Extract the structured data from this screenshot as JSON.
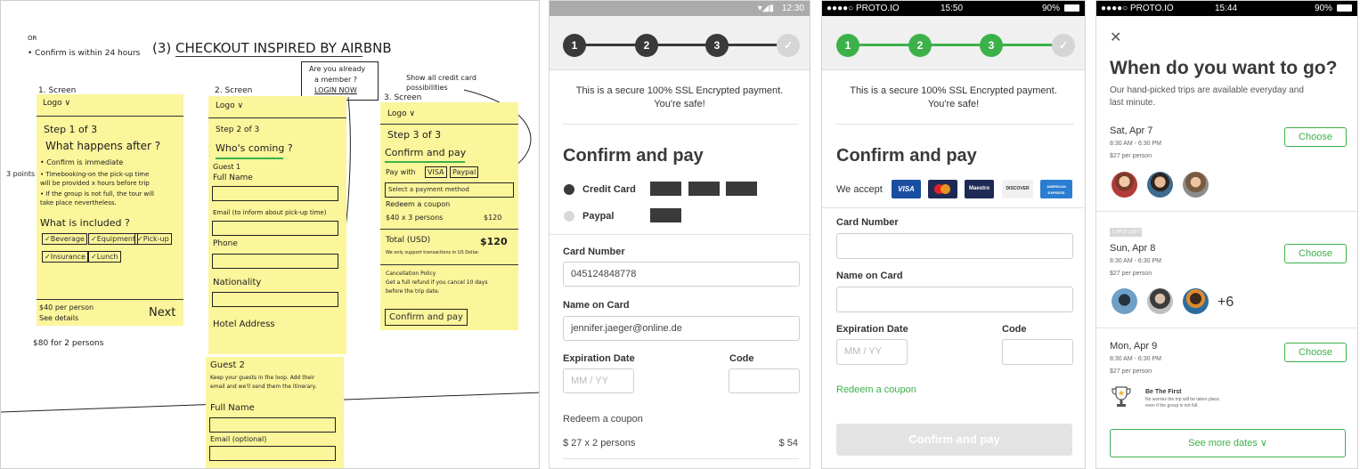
{
  "sketch": {
    "top_note_1": "OR",
    "top_note_2": "• Confirm is within 24 hours",
    "title": "(3) CHECKOUT  INSPIRED BY AIRBNB",
    "member_note_1": "Are you already",
    "member_note_2": "a member ?",
    "member_note_3": "LOGIN NOW",
    "cards_note_1": "Show all credit card",
    "cards_note_2": "possibilities",
    "side_note": "3 points",
    "s1": {
      "heading": "1. Screen",
      "logo": "Logo ∨",
      "step": "Step 1 of 3",
      "question": "What happens after ?",
      "b1": "• Confirm is immediate",
      "b2a": "• Timebooking-on the pick-up time",
      "b2b": "  will be provided x hours before trip",
      "b3a": "• If the group is not full, the tour will",
      "b3b": "  take place nevertheless.",
      "included": "What is included ?",
      "chips": [
        "✓Beverage",
        "✓Equipment",
        "✓Pick-up"
      ],
      "chips2": [
        "✓Insurance",
        "✓Lunch"
      ],
      "price": "$40 per person",
      "details": "See details",
      "next": "Next",
      "total": "$80 for 2 persons"
    },
    "s2": {
      "heading": "2. Screen",
      "logo": "Logo ∨",
      "step": "Step 2 of 3",
      "question": "Who's coming ?",
      "guest1": "Guest 1",
      "full_name": "Full Name",
      "email": "Email (to inform about pick-up time)",
      "phone": "Phone",
      "nationality": "Nationality",
      "hotel": "Hotel Address",
      "guest2": "Guest 2",
      "loop_a": "Keep your guests in the loop. Add their",
      "loop_b": "email and we'll send them the itinerary.",
      "full_name2": "Full Name",
      "email2": "Email (optional)"
    },
    "s3": {
      "heading": "3. Screen",
      "logo": "Logo ∨",
      "step": "Step 3 of 3",
      "question": "Confirm and pay",
      "pay_with": "Pay with",
      "chips": [
        "VISA",
        "Paypal"
      ],
      "select": "Select a payment method",
      "coupon": "Redeem a coupon",
      "calc": "$40 x 3 persons",
      "calc_val": "$120",
      "total": "Total (USD)",
      "total_val": "$120",
      "support": "We only support transactions in US Dollar.",
      "cancel_title": "Cancellation Policy",
      "cancel_a": "Get a full refund if you cancel 10 days",
      "cancel_b": "before the trip date.",
      "button": "Confirm and pay"
    }
  },
  "phone_a": {
    "time": "12:30",
    "steps": [
      "1",
      "2",
      "3",
      "✓"
    ],
    "secure_1": "This is a secure 100% SSL Encrypted payment.",
    "secure_2": "You're safe!",
    "title": "Confirm and pay",
    "options": [
      "Credit Card",
      "Paypal"
    ],
    "card_number_label": "Card Number",
    "card_number_value": "045124848778",
    "name_label": "Name on Card",
    "name_value": "jennifer.jaeger@online.de",
    "exp_label": "Expiration Date",
    "exp_placeholder": "MM / YY",
    "code_label": "Code",
    "coupon": "Redeem a coupon",
    "calc": "$ 27 x 2 persons",
    "calc_value": "$ 54",
    "accent": "#3a3a3a"
  },
  "phone_b": {
    "carrier": "●●●●○ PROTO.IO",
    "time": "15:50",
    "battery": "90%",
    "steps": [
      "1",
      "2",
      "3",
      "✓"
    ],
    "secure_1": "This is a secure 100% SSL Encrypted payment.",
    "secure_2": "You're safe!",
    "title": "Confirm and pay",
    "accept": "We accept",
    "cards": [
      "VISA",
      "Master",
      "Maestro",
      "DISCOVER",
      "AMERICAN EXPRESS"
    ],
    "card_number_label": "Card Number",
    "name_label": "Name on Card",
    "exp_label": "Expiration Date",
    "exp_placeholder": "MM / YY",
    "code_label": "Code",
    "coupon": "Redeem a coupon",
    "button": "Confirm and pay",
    "accent": "#3cb14a"
  },
  "phone_c": {
    "carrier": "●●●●○ PROTO.IO",
    "time": "15:44",
    "battery": "90%",
    "close": "✕",
    "title": "When do you want to go?",
    "subtitle_1": "Our hand-picked trips are available everyday and",
    "subtitle_2": "last minute.",
    "choose": "Choose",
    "dates": [
      {
        "date": "Sat, Apr 7",
        "time": "8:30 AM - 6:30 PM",
        "price": "$27 per person"
      },
      {
        "date": "Sun, Apr 8",
        "time": "8:30 AM - 6:30 PM",
        "price": "$27 per person",
        "badge": "1 SPOT LEFT",
        "extra": "+6"
      },
      {
        "date": "Mon, Apr 9",
        "time": "8:30 AM - 6:30 PM",
        "price": "$27 per person"
      }
    ],
    "first_title": "Be The First",
    "first_1": "No worries the trip will be taken place,",
    "first_2": "even if the group is not full.",
    "more": "See more dates ∨",
    "accent": "#3cb14a"
  }
}
